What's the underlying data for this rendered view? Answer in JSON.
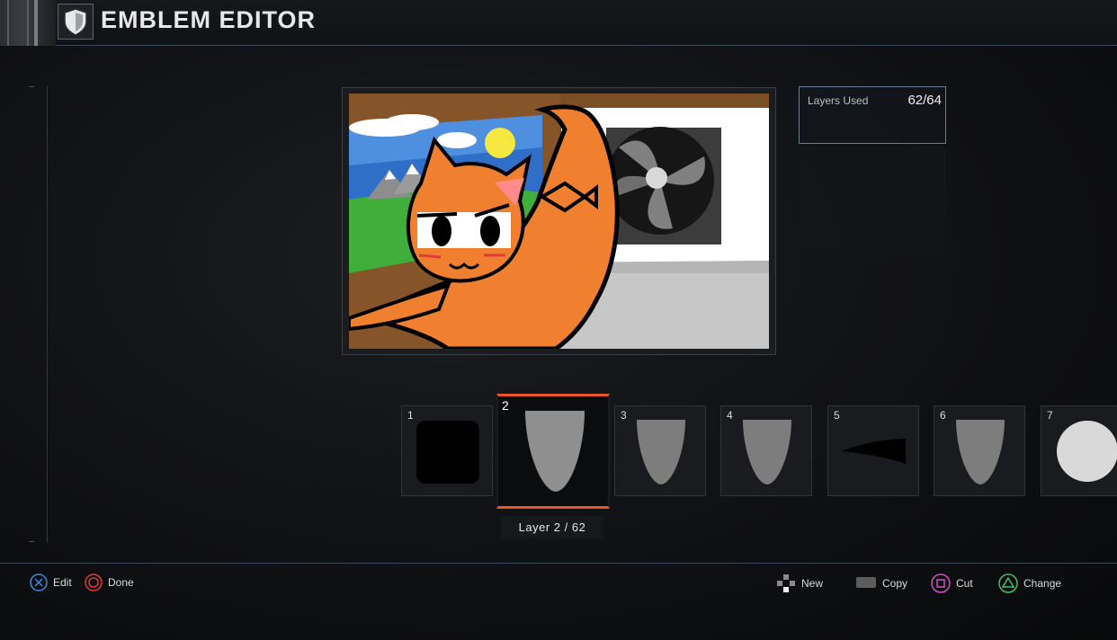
{
  "header": {
    "title": "EMBLEM EDITOR",
    "icon": "shield-icon"
  },
  "layers_used": {
    "label": "Layers Used",
    "value": "62/64"
  },
  "layers": [
    {
      "number": "1",
      "shape": "rounded-square"
    },
    {
      "number": "2",
      "shape": "cone",
      "selected": true
    },
    {
      "number": "3",
      "shape": "cone"
    },
    {
      "number": "4",
      "shape": "cone"
    },
    {
      "number": "5",
      "shape": "slash"
    },
    {
      "number": "6",
      "shape": "cone"
    },
    {
      "number": "7",
      "shape": "circle"
    }
  ],
  "layer_caption": "Layer 2 / 62",
  "footer": {
    "edit": "Edit",
    "done": "Done",
    "new": "New",
    "copy": "Copy",
    "cut": "Cut",
    "change": "Change"
  },
  "colors": {
    "accent": "#e8552b",
    "cat_orange": "#f08030",
    "cross_blue": "#3a8de0",
    "circle_red": "#e03a3a",
    "square_pink": "#d44fc6",
    "triangle_green": "#3fbf6a"
  }
}
